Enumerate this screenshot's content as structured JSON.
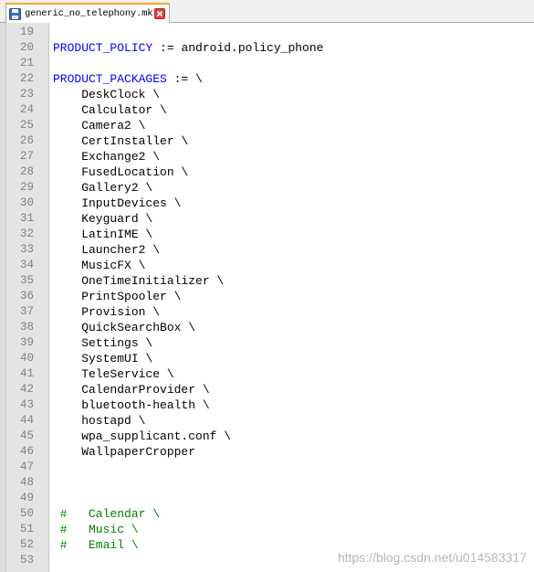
{
  "tab": {
    "filename": "generic_no_telephony.mk",
    "save_icon": "floppy-disk-icon",
    "close_icon": "close-icon"
  },
  "colors": {
    "keyword": "#0000ff",
    "comment": "#008000",
    "line_number": "#808080",
    "gutter_bg": "#e4e4e4",
    "tab_accent": "#f6a72a"
  },
  "lines": [
    {
      "num": "19",
      "kind": "blank",
      "text": ""
    },
    {
      "num": "20",
      "kind": "assign",
      "name": "PRODUCT_POLICY",
      "op": " := ",
      "value": "android.policy_phone"
    },
    {
      "num": "21",
      "kind": "blank",
      "text": ""
    },
    {
      "num": "22",
      "kind": "assign",
      "name": "PRODUCT_PACKAGES",
      "op": " := ",
      "value": "\\"
    },
    {
      "num": "23",
      "kind": "plain",
      "text": "    DeskClock \\"
    },
    {
      "num": "24",
      "kind": "plain",
      "text": "    Calculator \\"
    },
    {
      "num": "25",
      "kind": "plain",
      "text": "    Camera2 \\"
    },
    {
      "num": "26",
      "kind": "plain",
      "text": "    CertInstaller \\"
    },
    {
      "num": "27",
      "kind": "plain",
      "text": "    Exchange2 \\"
    },
    {
      "num": "28",
      "kind": "plain",
      "text": "    FusedLocation \\"
    },
    {
      "num": "29",
      "kind": "plain",
      "text": "    Gallery2 \\"
    },
    {
      "num": "30",
      "kind": "plain",
      "text": "    InputDevices \\"
    },
    {
      "num": "31",
      "kind": "plain",
      "text": "    Keyguard \\"
    },
    {
      "num": "32",
      "kind": "plain",
      "text": "    LatinIME \\"
    },
    {
      "num": "33",
      "kind": "plain",
      "text": "    Launcher2 \\"
    },
    {
      "num": "34",
      "kind": "plain",
      "text": "    MusicFX \\"
    },
    {
      "num": "35",
      "kind": "plain",
      "text": "    OneTimeInitializer \\"
    },
    {
      "num": "36",
      "kind": "plain",
      "text": "    PrintSpooler \\"
    },
    {
      "num": "37",
      "kind": "plain",
      "text": "    Provision \\"
    },
    {
      "num": "38",
      "kind": "plain",
      "text": "    QuickSearchBox \\"
    },
    {
      "num": "39",
      "kind": "plain",
      "text": "    Settings \\"
    },
    {
      "num": "40",
      "kind": "plain",
      "text": "    SystemUI \\"
    },
    {
      "num": "41",
      "kind": "plain",
      "text": "    TeleService \\"
    },
    {
      "num": "42",
      "kind": "plain",
      "text": "    CalendarProvider \\"
    },
    {
      "num": "43",
      "kind": "plain",
      "text": "    bluetooth-health \\"
    },
    {
      "num": "44",
      "kind": "plain",
      "text": "    hostapd \\"
    },
    {
      "num": "45",
      "kind": "plain",
      "text": "    wpa_supplicant.conf \\"
    },
    {
      "num": "46",
      "kind": "plain",
      "text": "    WallpaperCropper"
    },
    {
      "num": "47",
      "kind": "blank",
      "text": ""
    },
    {
      "num": "48",
      "kind": "blank",
      "text": ""
    },
    {
      "num": "49",
      "kind": "blank",
      "text": ""
    },
    {
      "num": "50",
      "kind": "comment",
      "text": " #   Calendar \\"
    },
    {
      "num": "51",
      "kind": "comment",
      "text": " #   Music \\"
    },
    {
      "num": "52",
      "kind": "comment",
      "text": " #   Email \\"
    },
    {
      "num": "53",
      "kind": "blank",
      "text": ""
    }
  ],
  "watermark": "https://blog.csdn.net/u014583317"
}
